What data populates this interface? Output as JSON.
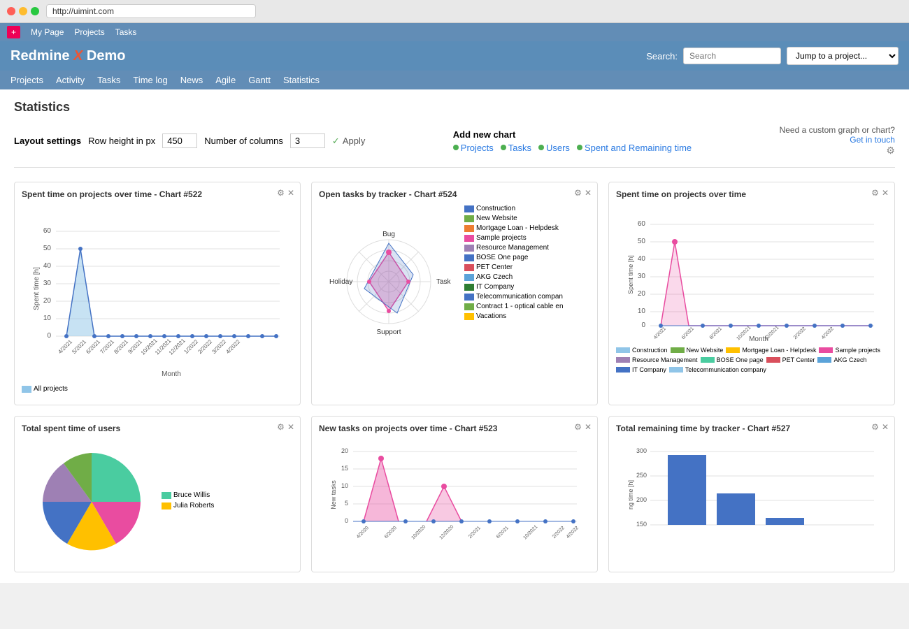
{
  "browser": {
    "url": "http://uimint.com"
  },
  "topbar": {
    "my_page": "My Page",
    "projects": "Projects",
    "tasks": "Tasks",
    "plus_label": "+"
  },
  "header": {
    "title": "Redmine X Demo",
    "search_label": "Search:",
    "search_placeholder": "Search",
    "project_placeholder": "Jump to a project..."
  },
  "nav": {
    "items": [
      "Projects",
      "Activity",
      "Tasks",
      "Time log",
      "News",
      "Agile",
      "Gantt",
      "Statistics"
    ]
  },
  "page": {
    "title": "Statistics"
  },
  "settings": {
    "layout_label": "Layout settings",
    "row_height_label": "Row height in px",
    "row_height_value": "450",
    "num_columns_label": "Number of columns",
    "num_columns_value": "3",
    "apply_label": "Apply"
  },
  "add_chart": {
    "title": "Add new chart",
    "links": [
      "Projects",
      "Tasks",
      "Users",
      "Spent and Remaining time"
    ]
  },
  "custom": {
    "text": "Need a custom graph or chart?",
    "link": "Get in touch"
  },
  "charts": {
    "top_row": [
      {
        "title": "Spent time on projects over time - Chart #522",
        "type": "line_area",
        "y_label": "Spent time [h]",
        "x_label": "Month",
        "legend": [
          {
            "label": "All projects",
            "color": "#90c5e8"
          }
        ]
      },
      {
        "title": "Open tasks by tracker - Chart #524",
        "type": "radar",
        "axes": [
          "Bug",
          "Task",
          "Support",
          "Holiday"
        ],
        "legend": [
          {
            "label": "Construction",
            "color": "#4472c4"
          },
          {
            "label": "New Website",
            "color": "#70ad47"
          },
          {
            "label": "Mortgage Loan - Helpdesk",
            "color": "#ed7d31"
          },
          {
            "label": "Sample projects",
            "color": "#e94ca0"
          },
          {
            "label": "Resource Management",
            "color": "#9e80b4"
          },
          {
            "label": "BOSE One page",
            "color": "#4472c4"
          },
          {
            "label": "PET Center",
            "color": "#d94f5c"
          },
          {
            "label": "AKG Czech",
            "color": "#5ba3d9"
          },
          {
            "label": "IT Company",
            "color": "#2e7d32"
          },
          {
            "label": "Telecommunication compan",
            "color": "#4472c4"
          },
          {
            "label": "Contract 1 - optical cable en",
            "color": "#70ad47"
          },
          {
            "label": "Vacations",
            "color": "#ffc000"
          }
        ]
      },
      {
        "title": "Spent time on projects over time",
        "type": "multi_line",
        "y_label": "Spent time [h]",
        "x_label": "Month",
        "legend": [
          {
            "label": "Construction",
            "color": "#90c5e8"
          },
          {
            "label": "New Website",
            "color": "#70ad47"
          },
          {
            "label": "Mortgage Loan - Helpdesk",
            "color": "#ffc000"
          },
          {
            "label": "Sample projects",
            "color": "#e94ca0"
          },
          {
            "label": "Resource Management",
            "color": "#9e80b4"
          },
          {
            "label": "BOSE One page",
            "color": "#4acca0"
          },
          {
            "label": "PET Center",
            "color": "#d94f5c"
          },
          {
            "label": "AKG Czech",
            "color": "#5ba3d9"
          },
          {
            "label": "IT Company",
            "color": "#4472c4"
          },
          {
            "label": "Telecommunication company",
            "color": "#90c5e8"
          }
        ]
      }
    ],
    "bottom_row": [
      {
        "title": "Total spent time of users",
        "type": "donut",
        "legend": [
          {
            "label": "Bruce Willis",
            "color": "#4acca0"
          },
          {
            "label": "Julia Roberts",
            "color": "#ffc000"
          }
        ]
      },
      {
        "title": "New tasks on projects over time - Chart #523",
        "type": "multi_line2",
        "y_label": "New tasks",
        "x_label": ""
      },
      {
        "title": "Total remaining time by tracker - Chart #527",
        "type": "bar",
        "y_label": "ng time [h]",
        "y_ticks": [
          150,
          200,
          250,
          300
        ]
      }
    ]
  }
}
